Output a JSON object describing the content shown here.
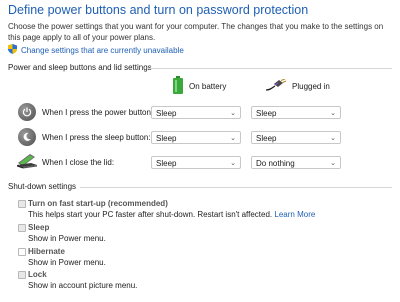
{
  "page": {
    "title": "Define power buttons and turn on password protection",
    "description": "Choose the power settings that you want for your computer. The changes that you make to the settings on this page apply to all of your power plans.",
    "change_settings_link": "Change settings that are currently unavailable"
  },
  "buttons_section": {
    "title": "Power and sleep buttons and lid settings",
    "col_battery": "On battery",
    "col_plugged": "Plugged in",
    "rows": [
      {
        "label": "When I press the power button:",
        "battery": "Sleep",
        "plugged": "Sleep"
      },
      {
        "label": "When I press the sleep button:",
        "battery": "Sleep",
        "plugged": "Sleep"
      },
      {
        "label": "When I close the lid:",
        "battery": "Sleep",
        "plugged": "Do nothing"
      }
    ]
  },
  "shutdown_section": {
    "title": "Shut-down settings",
    "items": [
      {
        "label": "Turn on fast start-up (recommended)",
        "desc": "This helps start your PC faster after shut-down. Restart isn't affected.",
        "link": "Learn More",
        "checked": true
      },
      {
        "label": "Sleep",
        "desc": "Show in Power menu.",
        "checked": true
      },
      {
        "label": "Hibernate",
        "desc": "Show in Power menu.",
        "checked": false
      },
      {
        "label": "Lock",
        "desc": "Show in account picture menu.",
        "checked": true
      }
    ]
  },
  "colors": {
    "accent": "#1e5fb4",
    "battery": "#3aa83a",
    "shield_blue": "#2b6fd6",
    "shield_yellow": "#f2c200"
  },
  "icons": [
    "shield-icon",
    "battery-icon",
    "plug-icon",
    "power-icon",
    "sleep-icon",
    "laptop-lid-icon",
    "chevron-down-icon"
  ]
}
